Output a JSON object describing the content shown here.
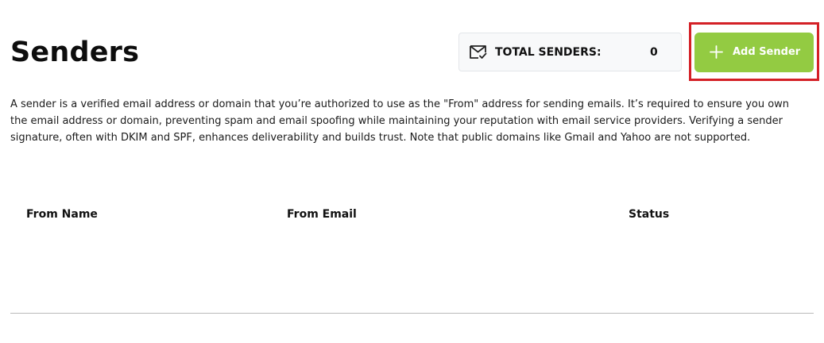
{
  "header": {
    "title": "Senders"
  },
  "total_senders": {
    "label": "TOTAL SENDERS:",
    "count": "0",
    "icon": "mail-check-icon"
  },
  "actions": {
    "add_sender_label": "Add Sender",
    "add_icon": "plus-icon",
    "accent_color": "#93cb42",
    "highlight_color": "#d42026"
  },
  "description": "A sender is a verified email address or domain that you’re authorized to use as the \"From\" address for sending emails. It’s required to ensure you own the email address or domain, preventing spam and email spoofing while maintaining your reputation with email service providers. Verifying a sender signature, often with DKIM and SPF, enhances deliverability and builds trust. Note that public domains like Gmail and Yahoo are not supported.",
  "table": {
    "columns": [
      "From Name",
      "From Email",
      "Status"
    ],
    "rows": []
  }
}
